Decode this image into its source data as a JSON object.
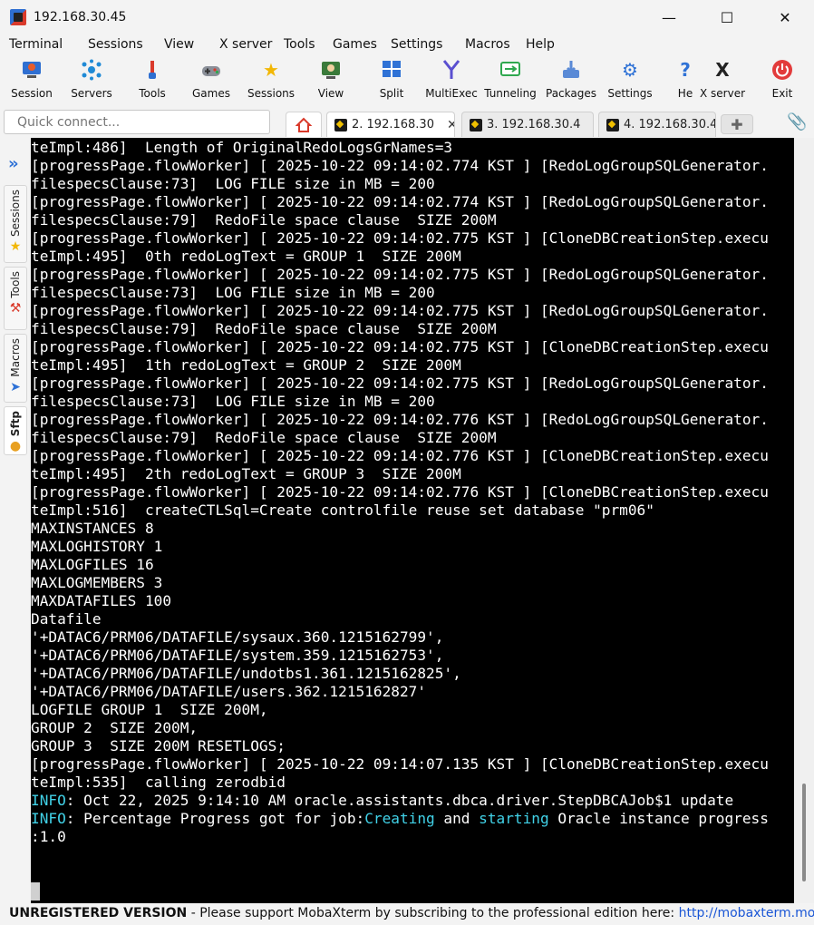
{
  "window": {
    "title": "192.168.30.45",
    "minimize": "—",
    "maximize": "☐",
    "close": "✕"
  },
  "menu": [
    "Terminal",
    "Sessions",
    "View",
    "X server",
    "Tools",
    "Games",
    "Settings",
    "Macros",
    "Help"
  ],
  "toolbar": [
    {
      "label": "Session",
      "icon": "session-icon"
    },
    {
      "label": "Servers",
      "icon": "servers-icon"
    },
    {
      "label": "Tools",
      "icon": "tools-icon"
    },
    {
      "label": "Games",
      "icon": "games-icon"
    },
    {
      "label": "Sessions",
      "icon": "star-icon"
    },
    {
      "label": "View",
      "icon": "view-icon"
    },
    {
      "label": "Split",
      "icon": "split-icon"
    },
    {
      "label": "MultiExec",
      "icon": "multiexec-icon"
    },
    {
      "label": "Tunneling",
      "icon": "tunneling-icon"
    },
    {
      "label": "Packages",
      "icon": "packages-icon"
    },
    {
      "label": "Settings",
      "icon": "gear-icon"
    },
    {
      "label": "He",
      "icon": "help-icon"
    },
    {
      "label": "X server",
      "icon": "xserver-icon"
    },
    {
      "label": "Exit",
      "icon": "power-icon"
    }
  ],
  "quick_connect": {
    "placeholder": "Quick connect..."
  },
  "tabs": [
    {
      "label": "2. 192.168.30",
      "close": "✕",
      "active": true
    },
    {
      "label": "3. 192.168.30.4",
      "active": false
    },
    {
      "label": "4. 192.168.30.4",
      "active": false
    }
  ],
  "sidebar": [
    "Sessions",
    "Tools",
    "Macros",
    "Sftp"
  ],
  "terminal": {
    "lines": [
      "teImpl:486]  Length of OriginalRedoLogsGrNames=3",
      "[progressPage.flowWorker] [ 2025-10-22 09:14:02.774 KST ] [RedoLogGroupSQLGenerator.",
      "filespecsClause:73]  LOG FILE size in MB = 200",
      "[progressPage.flowWorker] [ 2025-10-22 09:14:02.774 KST ] [RedoLogGroupSQLGenerator.",
      "filespecsClause:79]  RedoFile space clause  SIZE 200M",
      "[progressPage.flowWorker] [ 2025-10-22 09:14:02.775 KST ] [CloneDBCreationStep.execu",
      "teImpl:495]  0th redoLogText = GROUP 1  SIZE 200M",
      "[progressPage.flowWorker] [ 2025-10-22 09:14:02.775 KST ] [RedoLogGroupSQLGenerator.",
      "filespecsClause:73]  LOG FILE size in MB = 200",
      "[progressPage.flowWorker] [ 2025-10-22 09:14:02.775 KST ] [RedoLogGroupSQLGenerator.",
      "filespecsClause:79]  RedoFile space clause  SIZE 200M",
      "[progressPage.flowWorker] [ 2025-10-22 09:14:02.775 KST ] [CloneDBCreationStep.execu",
      "teImpl:495]  1th redoLogText = GROUP 2  SIZE 200M",
      "[progressPage.flowWorker] [ 2025-10-22 09:14:02.775 KST ] [RedoLogGroupSQLGenerator.",
      "filespecsClause:73]  LOG FILE size in MB = 200",
      "[progressPage.flowWorker] [ 2025-10-22 09:14:02.776 KST ] [RedoLogGroupSQLGenerator.",
      "filespecsClause:79]  RedoFile space clause  SIZE 200M",
      "[progressPage.flowWorker] [ 2025-10-22 09:14:02.776 KST ] [CloneDBCreationStep.execu",
      "teImpl:495]  2th redoLogText = GROUP 3  SIZE 200M",
      "[progressPage.flowWorker] [ 2025-10-22 09:14:02.776 KST ] [CloneDBCreationStep.execu",
      "teImpl:516]  createCTLSql=Create controlfile reuse set database \"prm06\"",
      "MAXINSTANCES 8",
      "MAXLOGHISTORY 1",
      "MAXLOGFILES 16",
      "MAXLOGMEMBERS 3",
      "MAXDATAFILES 100",
      "Datafile",
      "'+DATAC6/PRM06/DATAFILE/sysaux.360.1215162799',",
      "'+DATAC6/PRM06/DATAFILE/system.359.1215162753',",
      "'+DATAC6/PRM06/DATAFILE/undotbs1.361.1215162825',",
      "'+DATAC6/PRM06/DATAFILE/users.362.1215162827'",
      "LOGFILE GROUP 1  SIZE 200M,",
      "GROUP 2  SIZE 200M,",
      "GROUP 3  SIZE 200M RESETLOGS;",
      "[progressPage.flowWorker] [ 2025-10-22 09:14:07.135 KST ] [CloneDBCreationStep.execu",
      "teImpl:535]  calling zerodbid"
    ],
    "info1": {
      "tag": "INFO",
      "rest": ": Oct 22, 2025 9:14:10 AM oracle.assistants.dbca.driver.StepDBCAJob$1 update"
    },
    "info2": {
      "tag": "INFO",
      "a": ": Percentage Progress got for job:",
      "w1": "Creating",
      "b": " and ",
      "w2": "starting",
      "c": " Oracle instance progress"
    },
    "info2_cont": ":1.0"
  },
  "status": {
    "bold": "UNREGISTERED VERSION",
    "text": "  -  Please support MobaXterm by subscribing to the professional edition here:  ",
    "link": "http://mobaxterm.mobatek.net"
  },
  "colors": {
    "terminal_bg": "#000000",
    "info": "#41d2e8",
    "link": "#1a56d6"
  }
}
